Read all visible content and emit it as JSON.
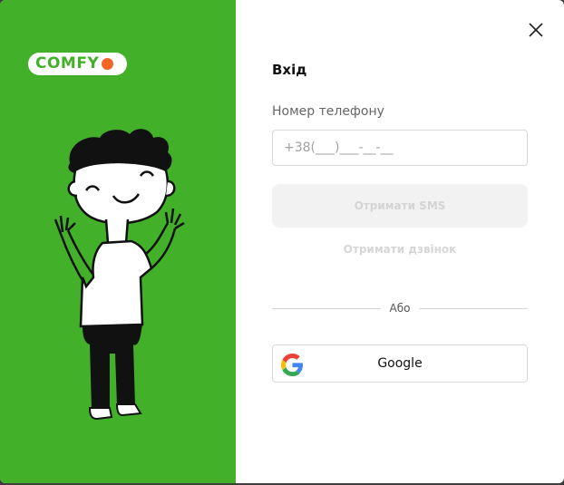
{
  "brand": {
    "logo_text": "COMFY",
    "green": "#43b02a",
    "orange": "#f26522"
  },
  "login": {
    "title": "Вхід",
    "phone_label": "Номер телефону",
    "phone_placeholder": "+38(___)___-__-__",
    "sms_button_label": "Отримати SMS",
    "call_link_label": "Отримати дзвінок",
    "divider_text": "Або",
    "google_button_label": "Google"
  },
  "icons": {
    "close": "close-icon",
    "google": "google-icon",
    "illustration": "waving-person-illustration"
  }
}
